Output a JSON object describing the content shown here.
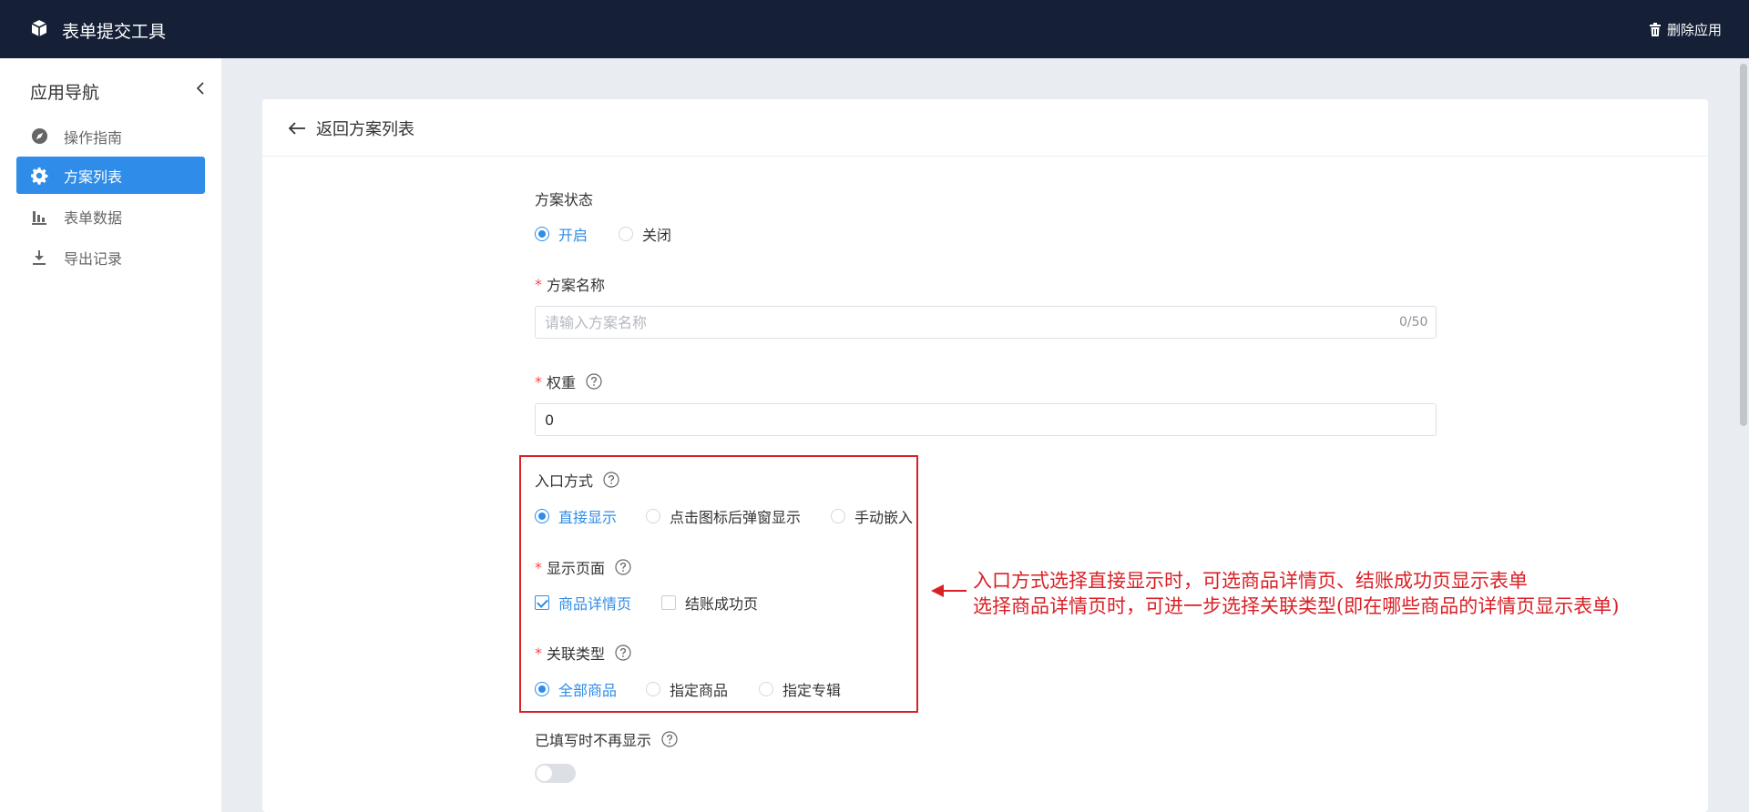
{
  "header": {
    "app_title": "表单提交工具",
    "delete_app_label": "删除应用"
  },
  "sidebar": {
    "title": "应用导航",
    "items": [
      {
        "label": "操作指南",
        "icon": "compass-icon",
        "active": false
      },
      {
        "label": "方案列表",
        "icon": "gear-icon",
        "active": true
      },
      {
        "label": "表单数据",
        "icon": "bar-chart-icon",
        "active": false
      },
      {
        "label": "导出记录",
        "icon": "download-icon",
        "active": false
      }
    ]
  },
  "main": {
    "back_label": "返回方案列表",
    "form": {
      "status": {
        "label": "方案状态",
        "options": [
          "开启",
          "关闭"
        ],
        "selected": "开启"
      },
      "name": {
        "label": "方案名称",
        "required": "*",
        "placeholder": "请输入方案名称",
        "value": "",
        "counter": "0/50"
      },
      "weight": {
        "label": "权重",
        "required": "*",
        "value": "0"
      },
      "entry": {
        "label": "入口方式",
        "options": [
          "直接显示",
          "点击图标后弹窗显示",
          "手动嵌入"
        ],
        "selected": "直接显示"
      },
      "display_page": {
        "label": "显示页面",
        "required": "*",
        "options": [
          "商品详情页",
          "结账成功页"
        ],
        "checked": [
          "商品详情页"
        ]
      },
      "relation_type": {
        "label": "关联类型",
        "required": "*",
        "options": [
          "全部商品",
          "指定商品",
          "指定专辑"
        ],
        "selected": "全部商品"
      },
      "hide_when_filled": {
        "label": "已填写时不再显示",
        "enabled": false
      }
    },
    "annotation": {
      "line1": "入口方式选择直接显示时，可选商品详情页、结账成功页显示表单",
      "line2": "选择商品详情页时，可进一步选择关联类型(即在哪些商品的详情页显示表单)",
      "color": "#d92026"
    }
  },
  "colors": {
    "topbar": "#152036",
    "accent": "#2f8ce8",
    "annotation_red": "#d92026"
  }
}
